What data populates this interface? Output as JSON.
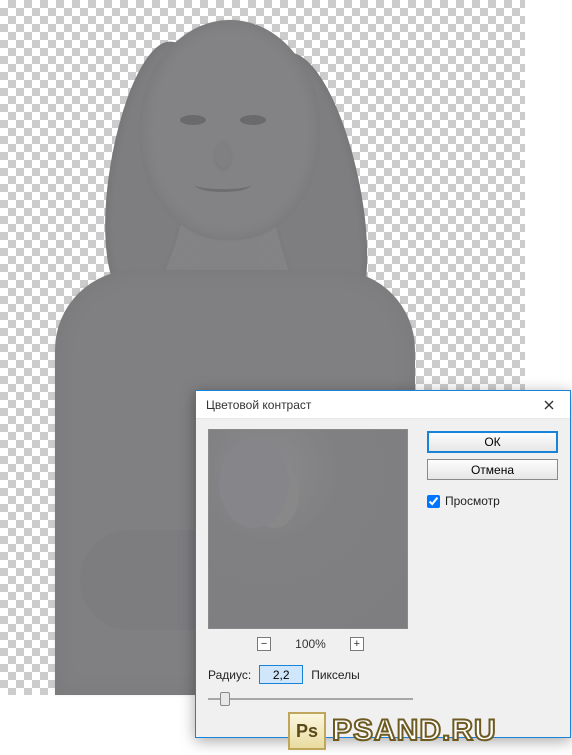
{
  "dialog": {
    "title": "Цветовой контраст",
    "ok_label": "ОК",
    "cancel_label": "Отмена",
    "preview_label": "Просмотр",
    "zoom_out_symbol": "−",
    "zoom_in_symbol": "+",
    "zoom_value": "100%",
    "radius_label": "Радиус:",
    "radius_value": "2,2",
    "radius_units": "Пикселы",
    "close_symbol": "×"
  },
  "watermark": {
    "badge_text": "Ps",
    "site_text": "PSAND.RU"
  }
}
